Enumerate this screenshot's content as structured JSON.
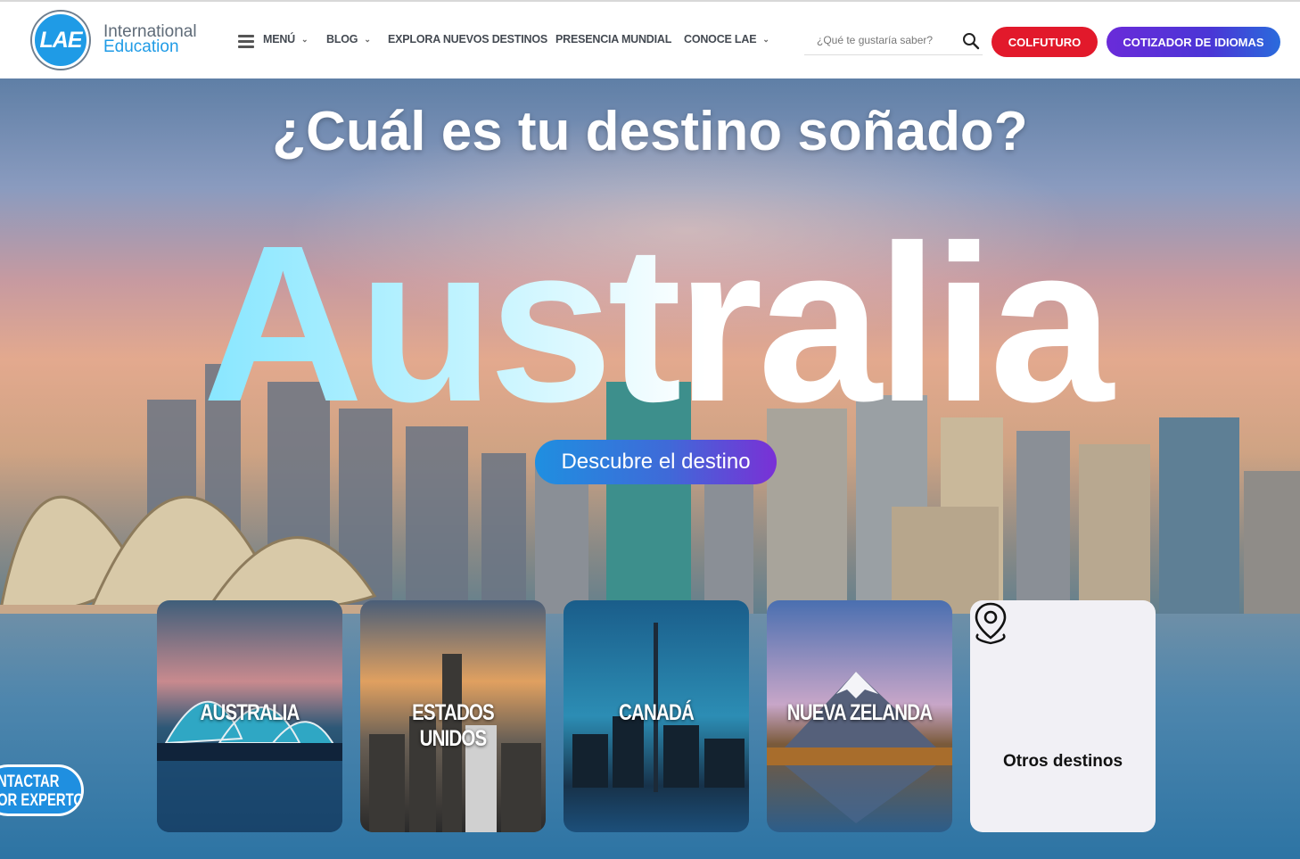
{
  "header": {
    "logo": {
      "mark": "LAE",
      "line1": "International",
      "line2": "Education"
    },
    "nav": {
      "menu": "MENÚ",
      "blog": "BLOG",
      "explora": "EXPLORA NUEVOS DESTINOS",
      "presencia": "PRESENCIA MUNDIAL",
      "conoce": "CONOCE LAE"
    },
    "search": {
      "placeholder": "¿Qué te gustaría saber?",
      "icon": "search-icon"
    },
    "buttons": {
      "colfuturo": "COLFUTURO",
      "cotizador": "COTIZADOR DE IDIOMAS"
    },
    "colors": {
      "brand_blue": "#1f9be6",
      "colfuturo_red": "#e2192b",
      "cotizador_purple": "#6a2bd9"
    }
  },
  "hero": {
    "title": "¿Cuál es tu destino soñado?",
    "highlight": "Australia",
    "cta": "Descubre el destino"
  },
  "destinations": [
    {
      "label": "AUSTRALIA"
    },
    {
      "label": "ESTADOS UNIDOS"
    },
    {
      "label": "CANADÁ"
    },
    {
      "label": "NUEVA ZELANDA"
    }
  ],
  "other_destinations": {
    "label": "Otros destinos",
    "icon": "location-pin-icon"
  },
  "floating": {
    "line1": "NTACTAR",
    "line2": "OR EXPERTO"
  }
}
